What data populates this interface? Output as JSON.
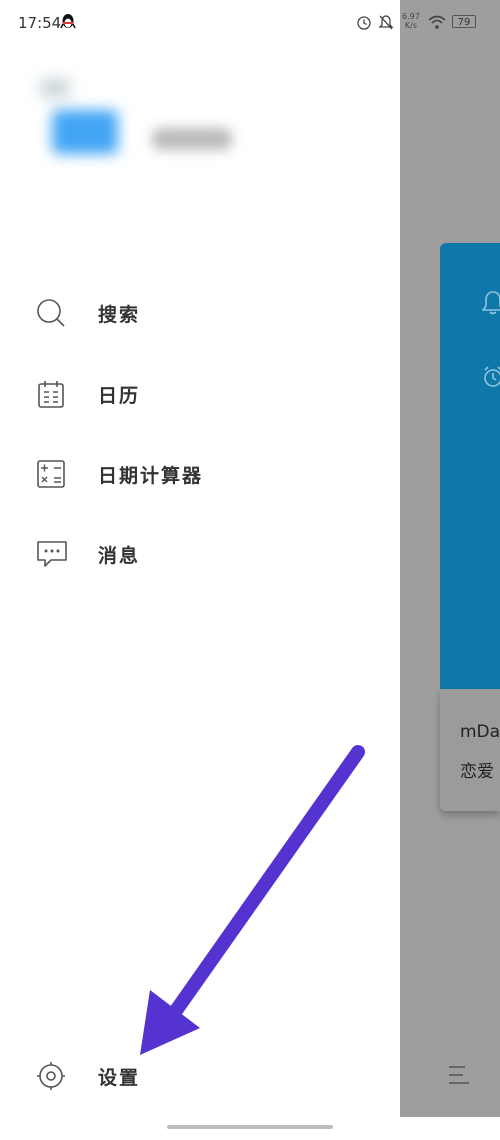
{
  "status_bar": {
    "time": "17:54",
    "net_speed_value": "6.97",
    "net_speed_unit": "K/s",
    "battery": "79"
  },
  "menu": {
    "items": [
      {
        "label": "搜索",
        "icon": "search-icon"
      },
      {
        "label": "日历",
        "icon": "calendar-icon"
      },
      {
        "label": "日期计算器",
        "icon": "calculator-icon"
      },
      {
        "label": "消息",
        "icon": "message-icon"
      }
    ],
    "settings_label": "设置",
    "settings_icon": "gear-icon"
  },
  "background_app": {
    "card_title": "mDa",
    "card_subtitle": "恋爱"
  },
  "colors": {
    "card_blue": "#0f78a8",
    "arrow": "#5533d1",
    "scrim": "#9e9e9e"
  }
}
